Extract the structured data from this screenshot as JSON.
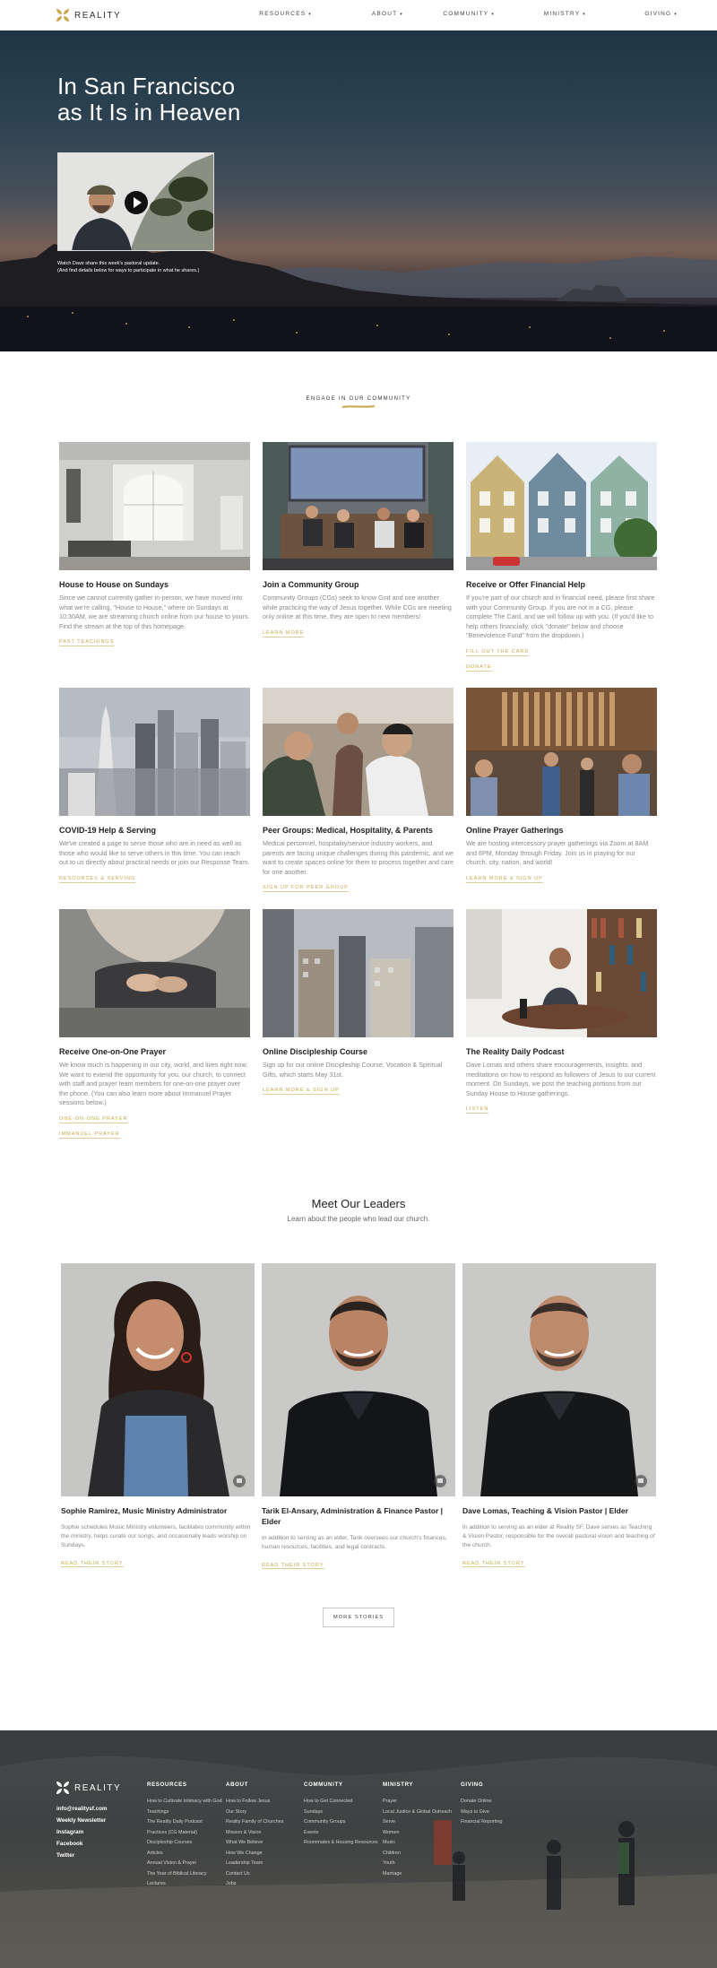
{
  "brand": {
    "name": "REALITY",
    "gold": "#c9a54e"
  },
  "nav": {
    "items": [
      {
        "label": "RESOURCES"
      },
      {
        "label": "ABOUT"
      },
      {
        "label": "COMMUNITY"
      },
      {
        "label": "MINISTRY"
      },
      {
        "label": "GIVING"
      }
    ]
  },
  "hero": {
    "title_line1": "In San Francisco",
    "title_line2": "as It Is in Heaven",
    "caption_line1": "Watch Dave share this week's pastoral update.",
    "caption_line2": "(And find details below for ways to participate in what he shares.)"
  },
  "engage": {
    "label": "ENGAGE IN OUR COMMUNITY",
    "cards": [
      {
        "title": "House to House on Sundays",
        "text": "Since we cannot currently gather in-person, we have moved into what we're calling, \"House to House,\" where on Sundays at 10:30AM, we are streaming church online from our house to yours. Find the stream at the top of this homepage.",
        "links": [
          "PAST TEACHINGS"
        ]
      },
      {
        "title": "Join a Community Group",
        "text": "Community Groups (CGs) seek to know God and one another while practicing the way of Jesus together. While CGs are meeting only online at this time, they are open to new members!",
        "links": [
          "LEARN MORE"
        ]
      },
      {
        "title": "Receive or Offer Financial Help",
        "text": "If you're part of our church and in financial need, please first share with your Community Group. If you are not in a CG, please complete The Card, and we will follow up with you. (If you'd like to help others financially, click \"donate\" below and choose \"Benevolence Fund\" from the dropdown.)",
        "links": [
          "FILL OUT THE CARD",
          "DONATE"
        ]
      },
      {
        "title": "COVID-19 Help & Serving",
        "text": "We've created a page to serve those who are in need as well as those who would like to serve others in this time. You can reach out to us directly about practical needs or join our Response Team.",
        "links": [
          "RESOURCES & SERVING"
        ]
      },
      {
        "title": "Peer Groups: Medical, Hospitality, & Parents",
        "text": "Medical personnel, hospitality/service industry workers, and parents are facing unique challenges during this pandemic, and we want to create spaces online for them to process together and care for one another.",
        "links": [
          "SIGN UP FOR PEER GROUP"
        ]
      },
      {
        "title": "Online Prayer Gatherings",
        "text": "We are hosting intercessory prayer gatherings via Zoom at 8AM and 6PM, Monday through Friday. Join us in praying for our church, city, nation, and world!",
        "links": [
          "LEARN MORE & SIGN UP"
        ]
      },
      {
        "title": "Receive One-on-One Prayer",
        "text": "We know much is happening in our city, world, and lives right now. We want to extend the opportunity for you, our church, to connect with staff and prayer team members for one-on-one prayer over the phone. (You can also learn more about Immanuel Prayer sessions below.)",
        "links": [
          "ONE-ON-ONE PRAYER",
          "IMMANUEL PRAYER"
        ]
      },
      {
        "title": "Online Discipleship Course",
        "text": "Sign up for our online Discipleship Course, Vocation & Spiritual Gifts, which starts May 31st.",
        "links": [
          "LEARN MORE & SIGN UP"
        ]
      },
      {
        "title": "The Reality Daily Podcast",
        "text": "Dave Lomas and others share encouragements, insights, and meditations on how to respond as followers of Jesus to our current moment. On Sundays, we post the teaching portions from our Sunday House to House gatherings.",
        "links": [
          "LISTEN"
        ]
      }
    ]
  },
  "leaders": {
    "title": "Meet Our Leaders",
    "subtitle": "Learn about the people who lead our church.",
    "people": [
      {
        "name": "Sophie Ramirez, Music Ministry Administrator",
        "bio": "Sophie schedules Music Ministry volunteers, facilitates community within the ministry, helps curate our songs, and occasionally leads worship on Sundays.",
        "link": "READ THEIR STORY"
      },
      {
        "name": "Tarik El-Ansary, Administration & Finance Pastor | Elder",
        "bio": "In addition to serving as an elder, Tarik oversees our church's finances, human resources, facilities, and legal contracts.",
        "link": "READ THEIR STORY"
      },
      {
        "name": "Dave Lomas, Teaching & Vision Pastor | Elder",
        "bio": "In addition to serving as an elder at Reality SF, Dave serves as Teaching & Vision Pastor, responsible for the overall pastoral vision and teaching of the church.",
        "link": "READ THEIR STORY"
      }
    ],
    "more_label": "MORE STORIES"
  },
  "footer": {
    "contact": [
      "info@realitysf.com",
      "Weekly Newsletter",
      "Instagram",
      "Facebook",
      "Twitter"
    ],
    "columns": [
      {
        "title": "RESOURCES",
        "items": [
          "How to Cultivate Intimacy with God",
          "Teachings",
          "The Reality Daily Podcast",
          "Practices (CG Material)",
          "Discipleship Courses",
          "Articles",
          "Annual Vision & Prayer",
          "The Year of Biblical Literacy",
          "Lectures"
        ]
      },
      {
        "title": "ABOUT",
        "items": [
          "How to Follow Jesus",
          "Our Story",
          "Reality Family of Churches",
          "Mission & Vision",
          "What We Believe",
          "How We Change",
          "Leadership Team",
          "Contact Us",
          "Jobs"
        ]
      },
      {
        "title": "COMMUNITY",
        "items": [
          "How to Get Connected",
          "Sundays",
          "Community Groups",
          "Events",
          "Roommates & Housing Resources"
        ]
      },
      {
        "title": "MINISTRY",
        "items": [
          "Prayer",
          "Local Justice & Global Outreach",
          "Serve",
          "Women",
          "Music",
          "Children",
          "Youth",
          "Marriage"
        ]
      },
      {
        "title": "GIVING",
        "items": [
          "Donate Online",
          "Ways to Give",
          "Financial Reporting"
        ]
      }
    ]
  }
}
